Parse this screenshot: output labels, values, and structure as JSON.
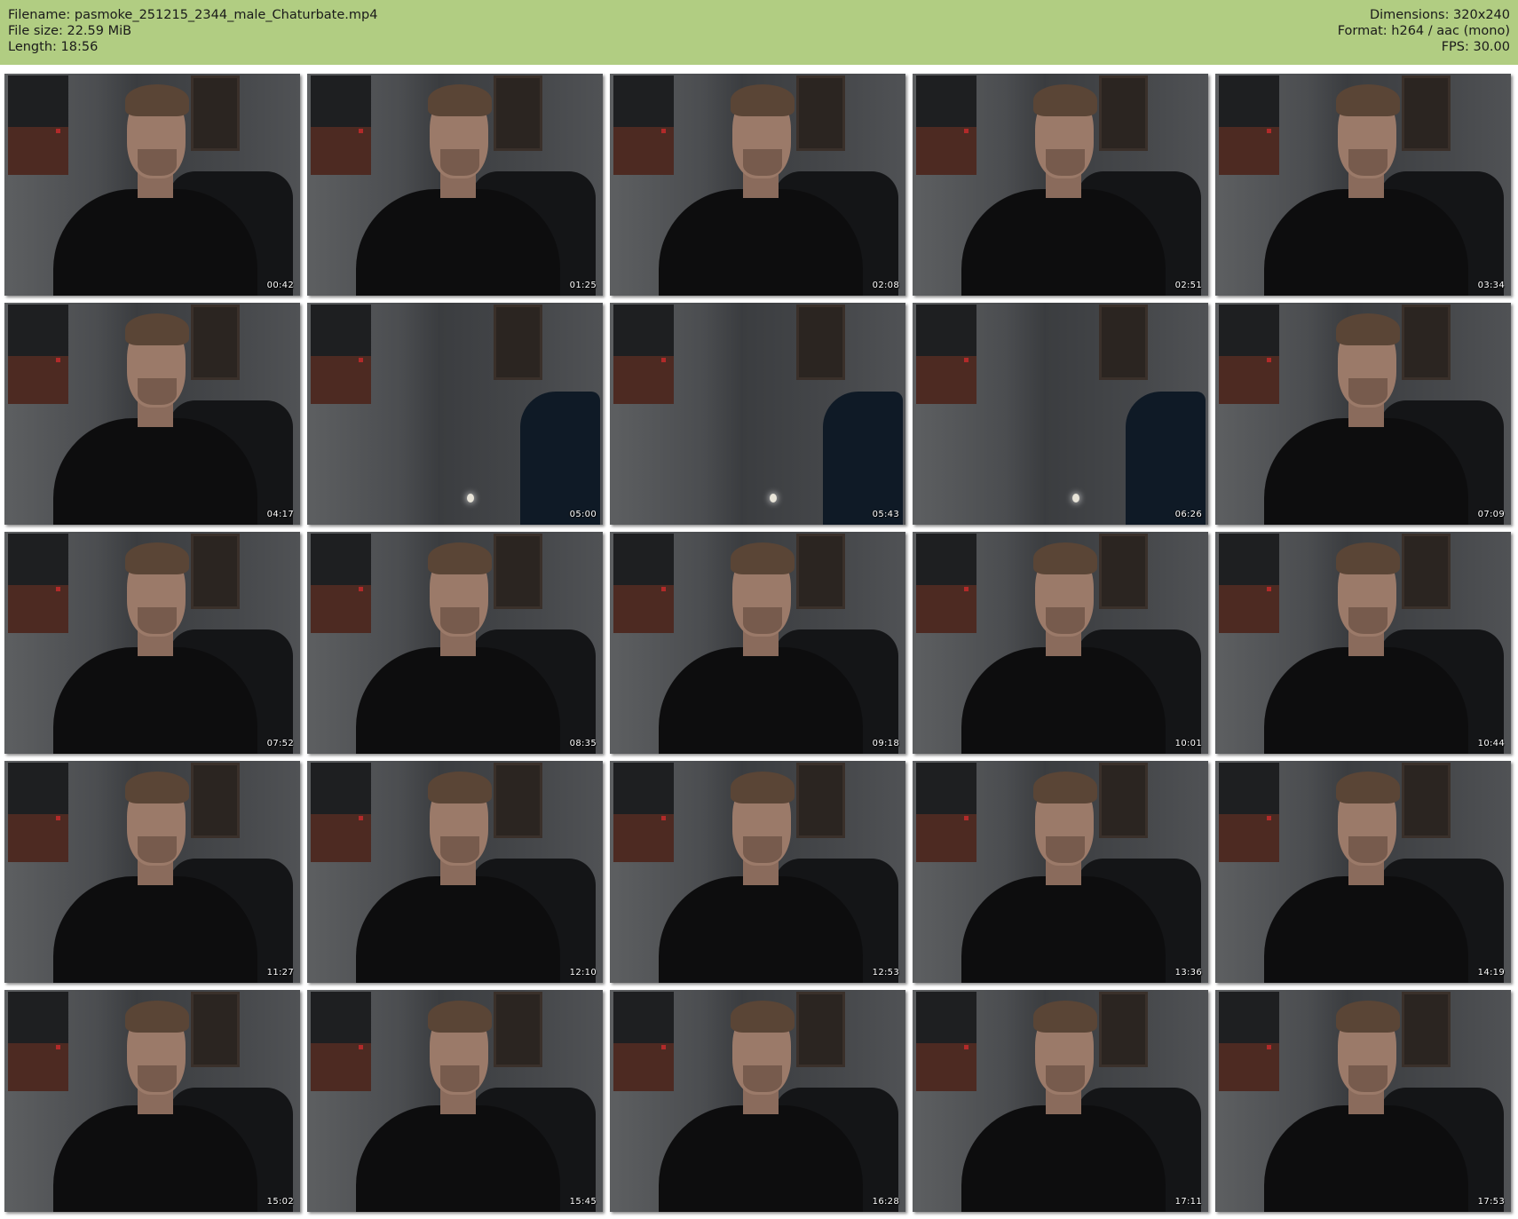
{
  "header": {
    "filename": "Filename: pasmoke_251215_2344_male_Chaturbate.mp4",
    "filesize": "File size: 22.59 MiB",
    "length": "Length: 18:56",
    "dimensions": "Dimensions: 320x240",
    "format": "Format: h264 / aac (mono)",
    "fps": "FPS: 30.00",
    "background_color": "#b1cd82"
  },
  "thumbnails": [
    {
      "time": "00:42",
      "scene": "person"
    },
    {
      "time": "01:25",
      "scene": "person"
    },
    {
      "time": "02:08",
      "scene": "person"
    },
    {
      "time": "02:51",
      "scene": "person"
    },
    {
      "time": "03:34",
      "scene": "person"
    },
    {
      "time": "04:17",
      "scene": "person"
    },
    {
      "time": "05:00",
      "scene": "empty"
    },
    {
      "time": "05:43",
      "scene": "empty"
    },
    {
      "time": "06:26",
      "scene": "empty"
    },
    {
      "time": "07:09",
      "scene": "person"
    },
    {
      "time": "07:52",
      "scene": "person"
    },
    {
      "time": "08:35",
      "scene": "person"
    },
    {
      "time": "09:18",
      "scene": "person"
    },
    {
      "time": "10:01",
      "scene": "person"
    },
    {
      "time": "10:44",
      "scene": "person"
    },
    {
      "time": "11:27",
      "scene": "person"
    },
    {
      "time": "12:10",
      "scene": "person"
    },
    {
      "time": "12:53",
      "scene": "person"
    },
    {
      "time": "13:36",
      "scene": "person"
    },
    {
      "time": "14:19",
      "scene": "person"
    },
    {
      "time": "15:02",
      "scene": "person"
    },
    {
      "time": "15:45",
      "scene": "person"
    },
    {
      "time": "16:28",
      "scene": "person"
    },
    {
      "time": "17:11",
      "scene": "person"
    },
    {
      "time": "17:53",
      "scene": "person"
    }
  ]
}
